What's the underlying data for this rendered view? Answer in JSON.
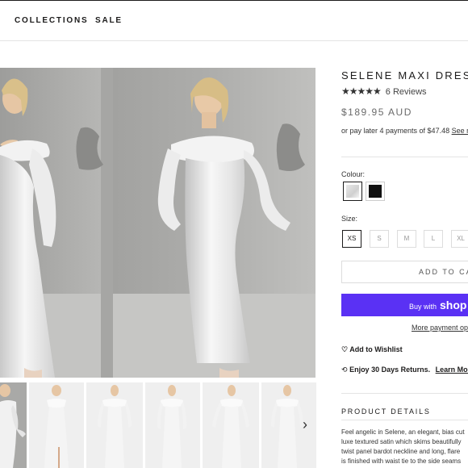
{
  "nav": {
    "items": [
      "COLLECTIONS",
      "SALE"
    ]
  },
  "product": {
    "title": "SELENE MAXI DRESS",
    "stars": "★★★★★",
    "rating": 4.5,
    "reviews": "6 Reviews",
    "price": "$189.95 AUD",
    "afterpay_text": "or pay later 4 payments of $47.48",
    "afterpay_link": "See mo",
    "colour_label": "Colour:",
    "colours": [
      "white",
      "black"
    ],
    "size_label": "Size:",
    "sizes": [
      "XS",
      "S",
      "M",
      "L",
      "XL"
    ],
    "selected_size": "XS",
    "add_to_cart": "ADD TO CART",
    "shop_pay_prefix": "Buy with",
    "shop_pay_brand": "shop",
    "more_payment": "More payment opti",
    "wishlist": "Add to Wishlist",
    "returns_text": "Enjoy 30 Days Returns.",
    "returns_link": "Learn More",
    "details_title": "PRODUCT DETAILS",
    "description_lines": [
      "Feel angelic in Selene, an elegant, bias cut",
      "luxe textured satin which skims beautifully",
      "twist panel bardot neckline and long, flare",
      "is finished with waist tie to the side seams"
    ]
  },
  "icons": {
    "rating": "star-icon",
    "wishlist": "heart-icon",
    "returns": "refresh-icon",
    "next": "chevron-right-icon"
  },
  "colors": {
    "shop_pay": "#5a31f4",
    "text": "#1c1b1b"
  }
}
